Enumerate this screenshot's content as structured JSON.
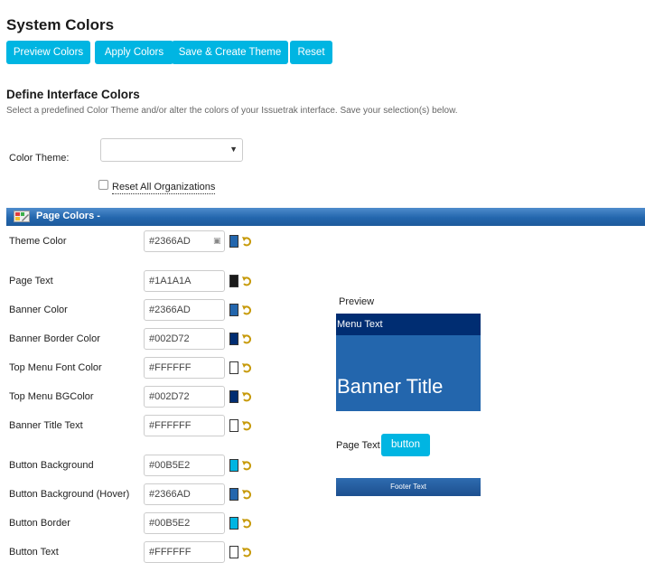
{
  "page_title": "System Colors",
  "toolbar": {
    "preview_label": "Preview Colors",
    "apply_label": "Apply Colors",
    "save_create_label": "Save & Create Theme",
    "reset_label": "Reset"
  },
  "section": {
    "title": "Define Interface Colors",
    "description": "Select a predefined Color Theme and/or alter the colors of your Issuetrak interface. Save your selection(s) below."
  },
  "color_theme": {
    "label": "Color Theme:",
    "selected": ""
  },
  "reset_all_orgs": {
    "label": "Reset All Organizations",
    "checked": false
  },
  "page_colors_header": "Page Colors -",
  "rows": [
    {
      "label": "Theme Color",
      "value": "#2366AD",
      "swatch": "#2366AD"
    },
    {
      "label": "Page Text",
      "value": "#1A1A1A",
      "swatch": "#1A1A1A"
    },
    {
      "label": "Banner Color",
      "value": "#2366AD",
      "swatch": "#2366AD"
    },
    {
      "label": "Banner Border Color",
      "value": "#002D72",
      "swatch": "#002D72"
    },
    {
      "label": "Top Menu Font Color",
      "value": "#FFFFFF",
      "swatch": "#FFFFFF"
    },
    {
      "label": "Top Menu BGColor",
      "value": "#002D72",
      "swatch": "#002D72"
    },
    {
      "label": "Banner Title Text",
      "value": "#FFFFFF",
      "swatch": "#FFFFFF"
    },
    {
      "label": "Button Background",
      "value": "#00B5E2",
      "swatch": "#00B5E2"
    },
    {
      "label": "Button Background (Hover)",
      "value": "#2366AD",
      "swatch": "#2366AD"
    },
    {
      "label": "Button Border",
      "value": "#00B5E2",
      "swatch": "#00B5E2"
    },
    {
      "label": "Button Text",
      "value": "#FFFFFF",
      "swatch": "#FFFFFF"
    }
  ],
  "preview": {
    "label": "Preview",
    "menu_text": "Menu Text",
    "banner_title": "Banner Title",
    "page_text": "Page Text",
    "button_text": "button",
    "footer_text": "Footer Text"
  },
  "colors": {
    "accent": "#00B5E2",
    "theme": "#2366AD",
    "banner_border": "#002D72",
    "page_text": "#1A1A1A"
  }
}
